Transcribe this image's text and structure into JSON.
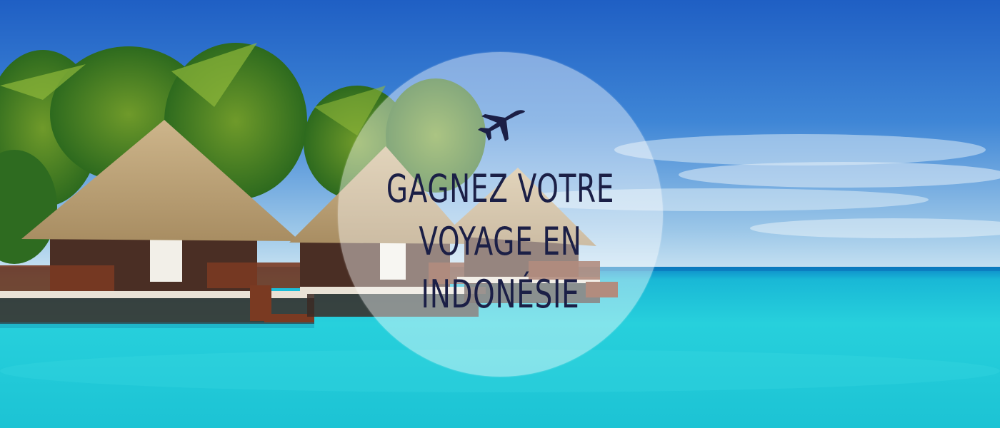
{
  "banner": {
    "headline_lines": [
      "GAGNEZ VOTRE",
      "VOYAGE EN",
      "INDONÉSIE"
    ],
    "icon": "airplane-icon"
  },
  "colors": {
    "headline_text": "#1b1f46",
    "icon": "#1b1f46",
    "sky_top": "#2c6fd0",
    "sky_horizon": "#a9cfea",
    "sea": "#22c9d8",
    "circle_overlay": "rgba(255,255,255,0.42)"
  }
}
